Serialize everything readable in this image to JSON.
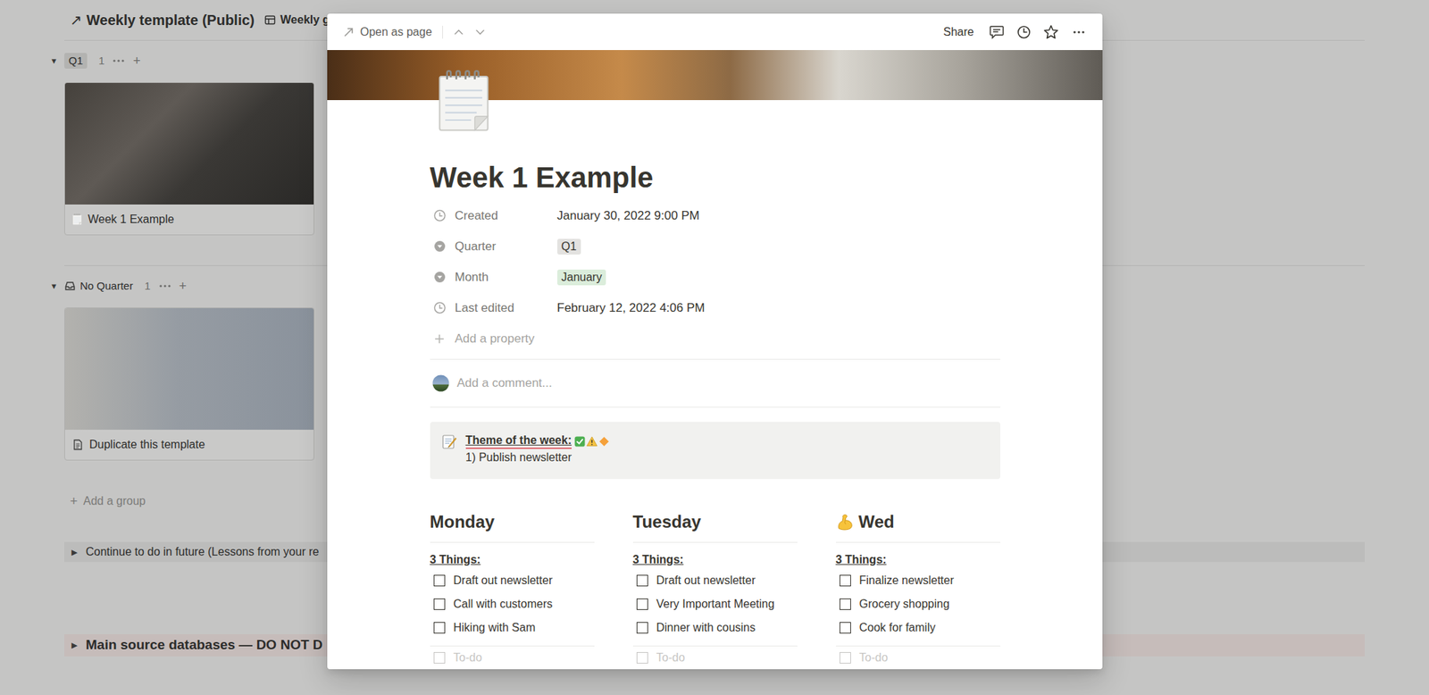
{
  "page": {
    "title_icon": "↗",
    "title": "Weekly template (Public)",
    "view": "Weekly g",
    "groups": [
      {
        "toggle": "▼",
        "name": "Q1",
        "kind": "tag",
        "count": "1",
        "add": "+",
        "cards": [
          {
            "title": "Week 1 Example",
            "kind": "laptop"
          }
        ]
      },
      {
        "toggle": "▼",
        "name": "No Quarter",
        "kind": "inbox",
        "count": "1",
        "add": "+",
        "cards": [
          {
            "title": "Duplicate this template",
            "kind": "blossom"
          }
        ]
      }
    ],
    "add_group": {
      "icon": "+",
      "label": "Add a group"
    },
    "toggles": [
      {
        "arrow": "▶",
        "label": "Continue to do in future (Lessons from your re",
        "kind": "text"
      },
      {
        "arrow": "▶",
        "label": "Main source databases — DO NOT D",
        "kind": "heading"
      }
    ]
  },
  "modal": {
    "open_as_page": "Open as page",
    "share": "Share",
    "title": "Week 1 Example",
    "properties": [
      {
        "label": "Created",
        "value": "January 30, 2022 9:00 PM",
        "kind": "datetime"
      },
      {
        "label": "Quarter",
        "value": "Q1",
        "kind": "select",
        "color": "#e3e2e0"
      },
      {
        "label": "Month",
        "value": "January",
        "kind": "select",
        "color": "#dbeddb"
      },
      {
        "label": "Last edited",
        "value": "February 12, 2022 4:06 PM",
        "kind": "datetime"
      }
    ],
    "add_property": "Add a property",
    "comment_placeholder": "Add a comment...",
    "callout": {
      "title": "Theme of the week:",
      "lines": [
        "1) Publish newsletter"
      ]
    },
    "days": [
      {
        "heading": "Monday",
        "kind": "plain",
        "subheading": "3 Things:",
        "placeholder": "To-do",
        "todos": [
          {
            "text": "Draft out newsletter",
            "checked": false
          },
          {
            "text": "Call with customers",
            "checked": false
          },
          {
            "text": "Hiking with Sam",
            "checked": false
          }
        ]
      },
      {
        "heading": "Tuesday",
        "kind": "plain",
        "subheading": "3 Things:",
        "placeholder": "To-do",
        "todos": [
          {
            "text": "Draft out newsletter",
            "checked": false
          },
          {
            "text": "Very Important Meeting",
            "checked": false
          },
          {
            "text": "Dinner with cousins",
            "checked": false
          }
        ]
      },
      {
        "heading": "Wed",
        "kind": "muscle",
        "subheading": "3 Things:",
        "placeholder": "To-do",
        "todos": [
          {
            "text": "Finalize newsletter",
            "checked": false
          },
          {
            "text": "Grocery shopping",
            "checked": false
          },
          {
            "text": "Cook for family",
            "checked": false
          }
        ]
      }
    ]
  }
}
